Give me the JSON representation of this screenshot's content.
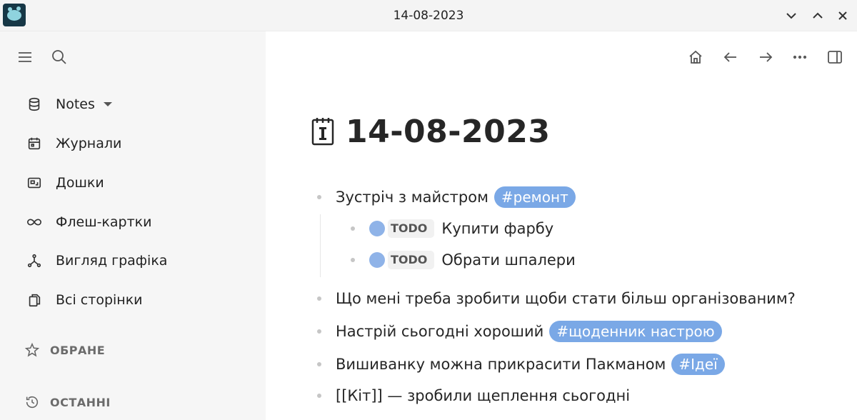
{
  "window": {
    "title": "14-08-2023"
  },
  "sidebar": {
    "items": [
      {
        "label": "Notes",
        "icon": "database-icon"
      },
      {
        "label": "Журнали",
        "icon": "calendar-icon"
      },
      {
        "label": "Дошки",
        "icon": "whiteboard-icon"
      },
      {
        "label": "Флеш-картки",
        "icon": "infinity-icon"
      },
      {
        "label": "Вигляд графіка",
        "icon": "graph-icon"
      },
      {
        "label": "Всі сторінки",
        "icon": "pages-icon"
      }
    ],
    "sections": [
      {
        "label": "ОБРАНЕ",
        "icon": "star-icon"
      },
      {
        "label": "ОСТАННІ",
        "icon": "history-icon"
      }
    ]
  },
  "page": {
    "title": "14-08-2023",
    "title_icon": "calendar-page-emoji-icon",
    "blocks": [
      {
        "text": "Зустріч з майстром",
        "tag": "#ремонт"
      },
      {
        "todo_marker": "TODO",
        "text": "Купити фарбу"
      },
      {
        "todo_marker": "TODO",
        "text": "Обрати шпалери"
      },
      {
        "text": "Що мені треба зробити щоби стати більш організованим?"
      },
      {
        "text": "Настрій сьогодні хороший",
        "tag": "#щоденник настрою"
      },
      {
        "text": "Вишиванку можна прикрасити Пакманом",
        "tag": "#Ідеї"
      },
      {
        "text": "[[Кіт]] — зробили щеплення сьогодні"
      }
    ]
  },
  "colors": {
    "tag_bg": "#7aa8e6",
    "todo_check": "#8fb3e8",
    "sidebar_bg": "#f6f6f6"
  }
}
